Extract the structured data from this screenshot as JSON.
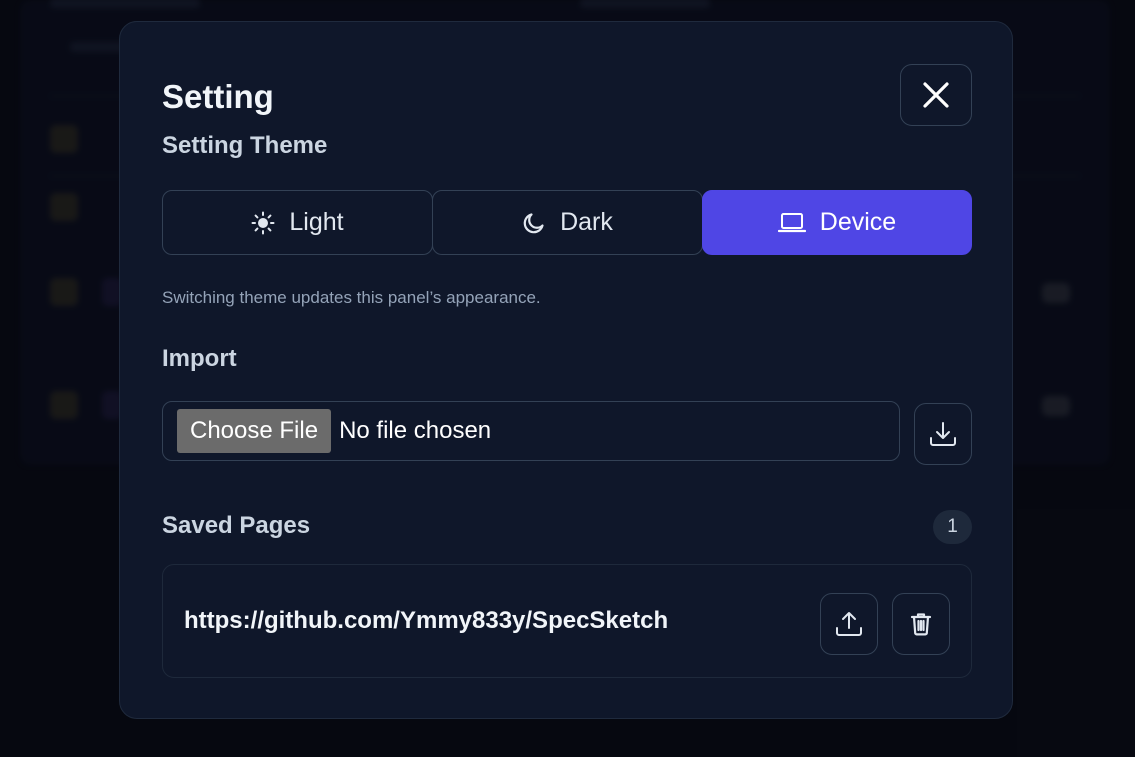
{
  "modal": {
    "title": "Setting",
    "theme_section_label": "Setting Theme",
    "themes": [
      {
        "label": "Light",
        "icon": "sun-icon",
        "active": false
      },
      {
        "label": "Dark",
        "icon": "moon-icon",
        "active": false
      },
      {
        "label": "Device",
        "icon": "laptop-icon",
        "active": true
      }
    ],
    "theme_hint": "Switching theme updates this panel’s appearance.",
    "import_label": "Import",
    "file_input": {
      "button_label": "Choose File",
      "status": "No file chosen"
    },
    "saved_pages_label": "Saved Pages",
    "saved_pages_count": "1",
    "saved_pages": [
      {
        "url": "https://github.com/Ymmy833y/SpecSketch"
      }
    ]
  },
  "colors": {
    "modal_bg": "#0f172a",
    "accent": "#4f46e5",
    "border": "#334155",
    "text_primary": "#f1f5f9",
    "text_muted": "#94a3b8"
  },
  "icons": [
    "close-icon",
    "sun-icon",
    "moon-icon",
    "laptop-icon",
    "download-icon",
    "upload-icon",
    "trash-icon"
  ]
}
